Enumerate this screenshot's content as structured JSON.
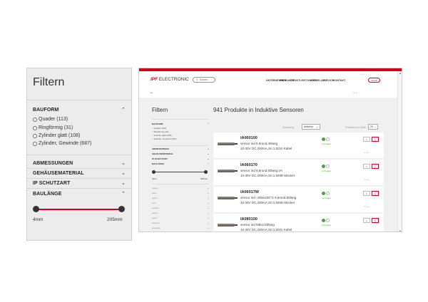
{
  "zoom": {
    "title": "Filtern",
    "bauform_label": "BAUFORM",
    "options": [
      "Quader (113)",
      "Ringförmig (31)",
      "Zylinder glatt (108)",
      "Zylinder, Gewinde (687)"
    ],
    "abmessungen": "ABMESSUNGEN",
    "gehaeusematerial": "GEHÄUSEMATERIAL",
    "ip_schutzart": "IP SCHUTZART",
    "baulaenge": "BAULÄNGE",
    "range_min": "4mm",
    "range_max": "205mm"
  },
  "shot": {
    "logo_brand": "IPF",
    "logo_rest": " ELECTRONIC",
    "search_placeholder": "Suchen",
    "nav": [
      "UNTERNEHMEN",
      "PRODUKTE",
      "DIENSTLEISTUNGEN",
      "AKTUELLES",
      "SERVICE",
      "KONTAKT"
    ],
    "shop": "SHOP",
    "filter_title": "Filtern",
    "heading": "941 Produkte in Induktive Sensoren",
    "sort_label": "Sortierung",
    "sort_value": "Artikelnr.",
    "per_page_label": "Produkte pro Seite",
    "per_page_value": "20",
    "bauform": "BAUFORM",
    "options": [
      "Quader (113)",
      "Ringförmig (31)",
      "Zylinder glatt (108)",
      "Zylinder, Gewinde (687)"
    ],
    "abmessungen": "ABMESSUNGEN",
    "gehaeusematerial": "GEHÄUSEMATERIAL",
    "ip_schutzart": "IP SCHUTZART",
    "baulaenge": "BAULÄNGE",
    "range_min": "4mm",
    "range_max": "205mm",
    "products": [
      {
        "code": "IA060100",
        "line1": "sensor ind 6,5rund,40lang",
        "line2": "10-30V DC,200mA,Sn:1,5/2m Kabel",
        "stock": "Auf Lager"
      },
      {
        "code": "IA060170",
        "line1": "sensor ind 6,5rund,50lang,VA",
        "line2": "10-30V DC,200mA,Sn:1,5/M8-Stecker",
        "stock": "Auf Lager"
      },
      {
        "code": "IA06017W",
        "line1": "sensor ind -40bis100°C 6,5rund,50lang",
        "line2": "10-30V DC,200mA,Sn:1,5/M8-Stecker",
        "stock": "Auf Lager"
      },
      {
        "code": "IA080100",
        "line1": "sensor ind M8x1/40lang",
        "line2": "10-30V DC,200mA,Sn:1,5/2m Kabel",
        "stock": "Auf Lager"
      }
    ]
  }
}
